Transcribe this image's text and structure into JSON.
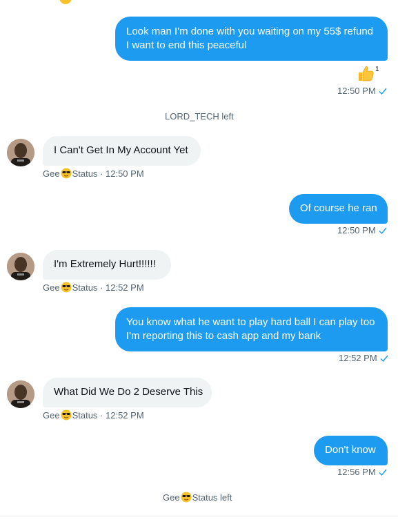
{
  "messages": [
    {
      "from": "me",
      "text": [
        "Look man I'm done with you waiting on my 55$ refund",
        "I want to end this peaceful"
      ],
      "reaction": {
        "icon": "thumbs-up-icon",
        "count": "1"
      },
      "time": "12:50 PM"
    },
    {
      "system": "LORD_TECH left"
    },
    {
      "from": "other",
      "text": "I Can't Get In My Account Yet",
      "sender": "Gee",
      "sender_suffix": "Status",
      "time": "12:50 PM"
    },
    {
      "from": "me",
      "text": "Of course he ran",
      "time": "12:50 PM"
    },
    {
      "from": "other",
      "text": "I'm Extremely Hurt!!!!!!",
      "sender": "Gee",
      "sender_suffix": "Status",
      "time": "12:52 PM"
    },
    {
      "from": "me",
      "text": [
        "You know what he want to play hard ball I can play too",
        "I'm reporting this to cash app and my bank"
      ],
      "time": "12:52 PM"
    },
    {
      "from": "other",
      "text": "What Did We Do 2 Deserve This",
      "sender": "Gee",
      "sender_suffix": "Status",
      "time": "12:52 PM"
    },
    {
      "from": "me",
      "text": "Don't know",
      "time": "12:56 PM"
    },
    {
      "system_prefix": "Gee",
      "system_suffix": "Status left"
    }
  ],
  "separator": " · ",
  "colors": {
    "accent": "#1d9bf0",
    "incoming_bg": "#eff3f4",
    "meta": "#536471"
  }
}
